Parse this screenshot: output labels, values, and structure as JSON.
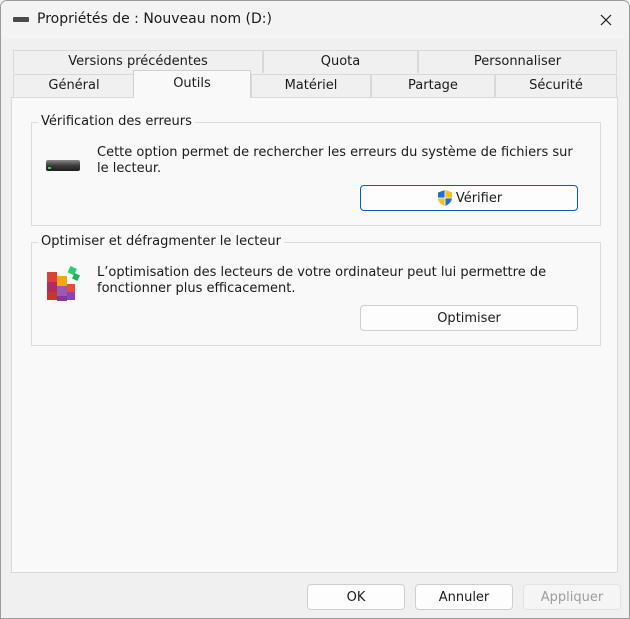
{
  "window": {
    "title": "Propriétés de : Nouveau nom (D:)"
  },
  "tabs_top": [
    {
      "label": "Versions précédentes"
    },
    {
      "label": "Quota"
    },
    {
      "label": "Personnaliser"
    }
  ],
  "tabs_bottom": [
    {
      "label": "Général"
    },
    {
      "label": "Outils",
      "selected": true
    },
    {
      "label": "Matériel"
    },
    {
      "label": "Partage"
    },
    {
      "label": "Sécurité"
    }
  ],
  "error_check": {
    "title": "Vérification des erreurs",
    "description": "Cette option permet de rechercher les erreurs du système de fichiers sur le lecteur.",
    "button_label": "Vérifier",
    "icon": "drive-icon"
  },
  "optimize": {
    "title": "Optimiser et défragmenter le lecteur",
    "description": "L’optimisation des lecteurs de votre ordinateur peut lui permettre de fonctionner plus efficacement.",
    "button_label": "Optimiser",
    "icon": "defrag-icon"
  },
  "footer": {
    "ok_label": "OK",
    "cancel_label": "Annuler",
    "apply_label": "Appliquer"
  },
  "colors": {
    "accent": "#005fb8"
  }
}
